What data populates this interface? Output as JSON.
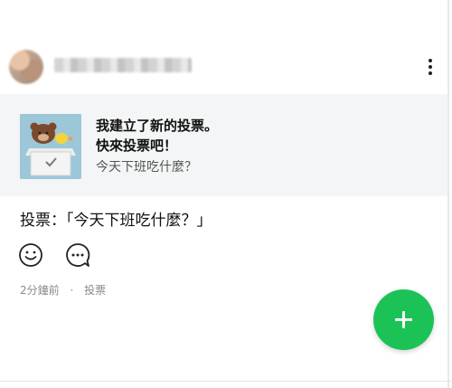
{
  "poll_card": {
    "title_line1": "我建立了新的投票。",
    "title_line2": "快來投票吧！",
    "subtitle": "今天下班吃什麼？"
  },
  "post": {
    "text": "投票：「今天下班吃什麼？」"
  },
  "meta": {
    "time": "2分鐘前",
    "separator": "·",
    "category": "投票"
  },
  "colors": {
    "fab": "#1bc356",
    "card_bg": "#f4f5f6"
  },
  "icons": [
    "more-vertical-icon",
    "smile-icon",
    "comment-icon",
    "plus-icon"
  ]
}
